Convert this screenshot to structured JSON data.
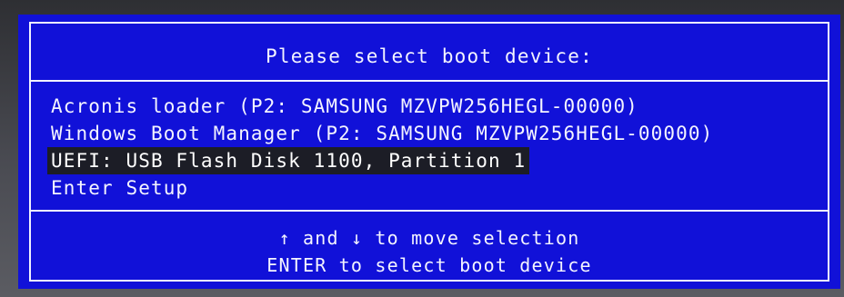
{
  "dialog": {
    "title": "Please select boot device:",
    "items": [
      {
        "label": "Acronis loader (P2: SAMSUNG MZVPW256HEGL-00000)",
        "selected": false
      },
      {
        "label": "Windows Boot Manager (P2: SAMSUNG MZVPW256HEGL-00000)",
        "selected": false
      },
      {
        "label": "UEFI: USB Flash Disk 1100, Partition 1",
        "selected": true
      },
      {
        "label": "Enter Setup",
        "selected": false
      }
    ],
    "help": {
      "line1": "↑ and ↓ to move selection",
      "line2": "ENTER to select boot device"
    }
  },
  "colors": {
    "screen_bg": "#1111d8",
    "text": "#f4f4ff",
    "selection_bg": "#1c1d26"
  }
}
